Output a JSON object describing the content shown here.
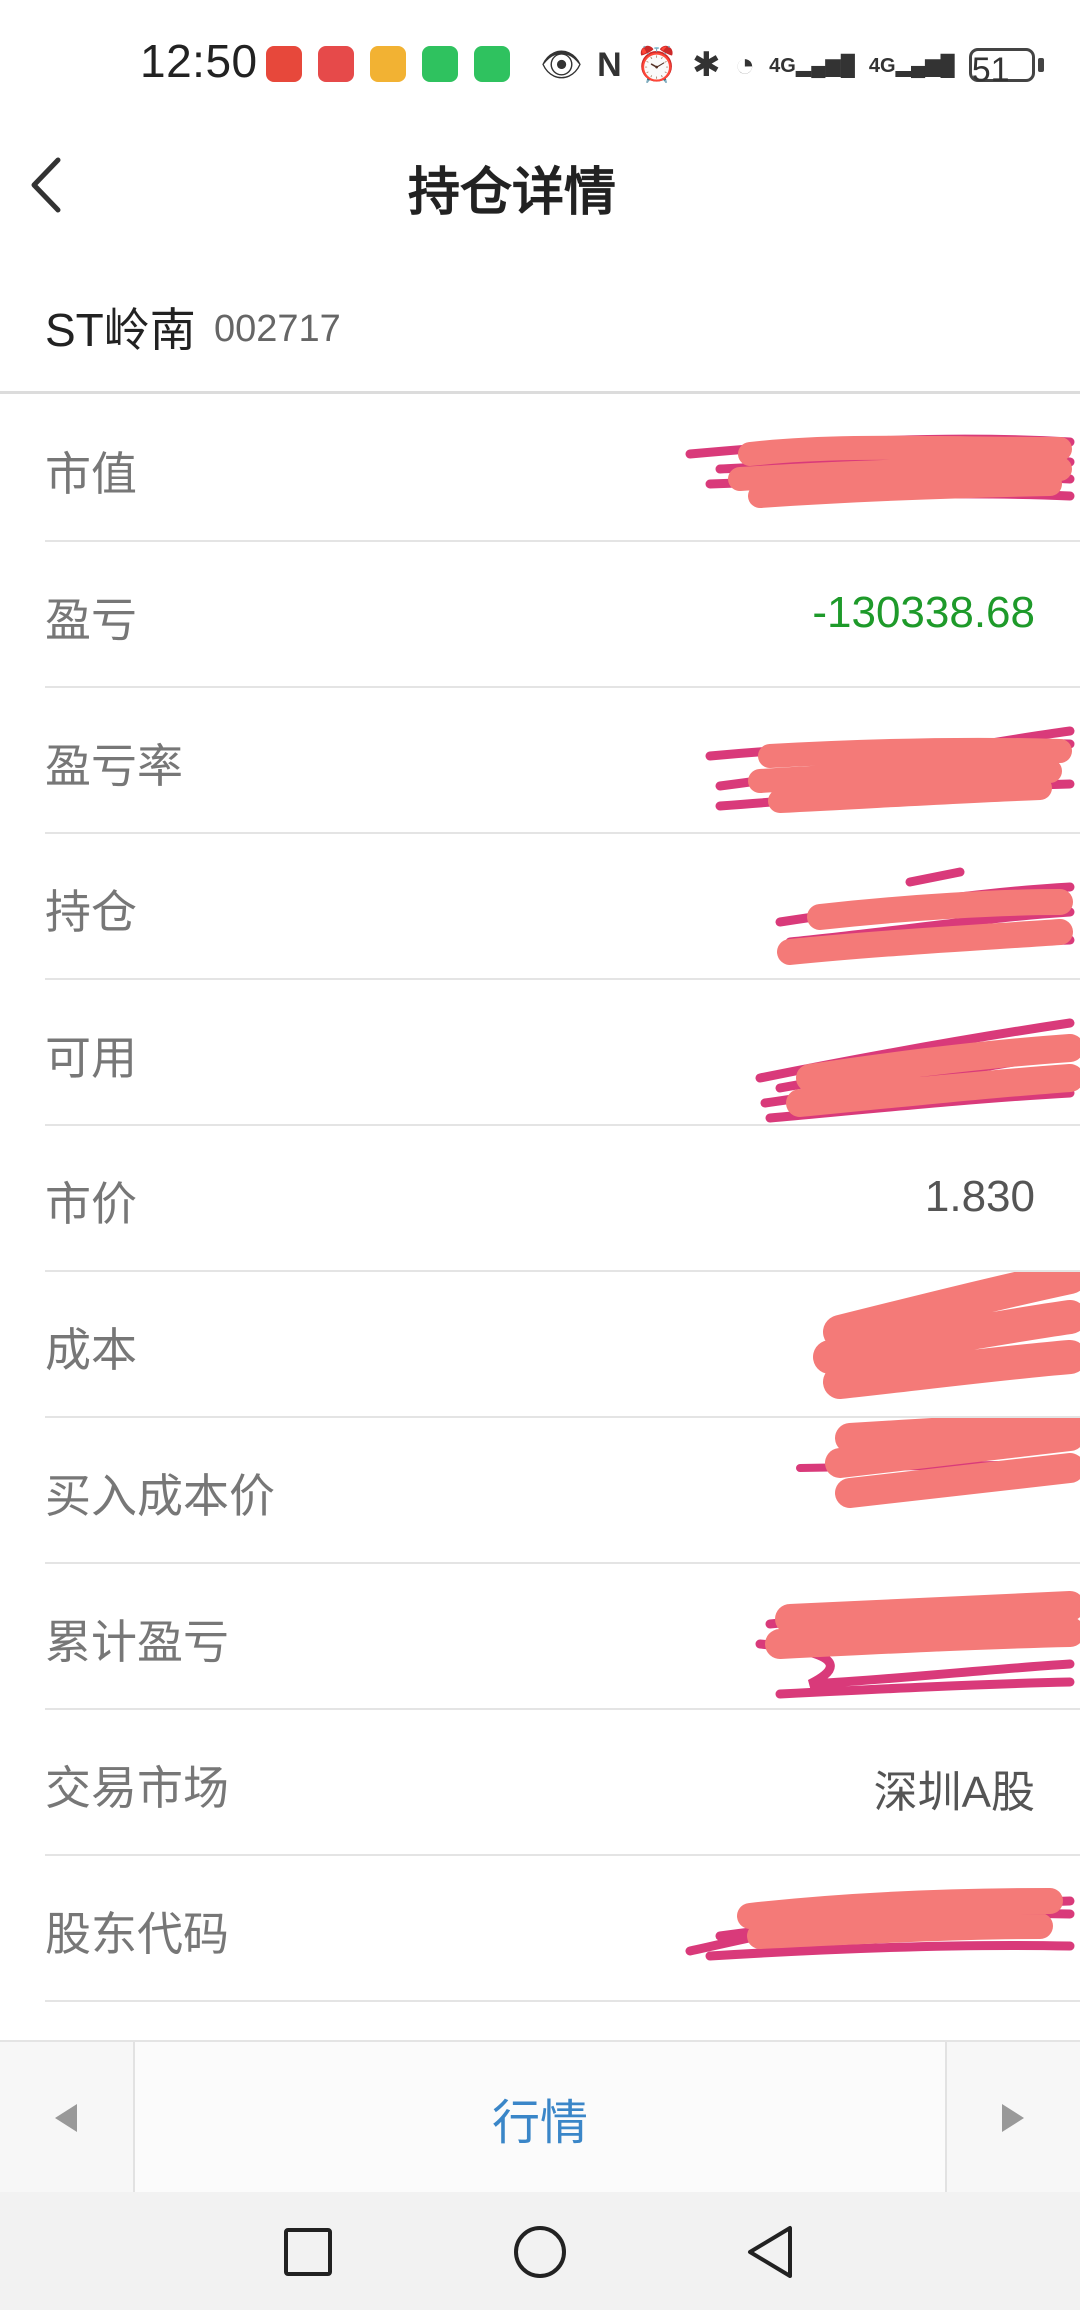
{
  "status_bar": {
    "time": "12:50",
    "notification_icons": [
      "app-red-icon",
      "app-book-icon",
      "weibo-icon",
      "wechat-icon",
      "wechat-icon"
    ],
    "notification_colors": [
      "#e7483b",
      "#e64a4a",
      "#f2b233",
      "#2fc25f",
      "#2fc25f"
    ],
    "system_icons": [
      "eye-icon",
      "nfc-icon",
      "alarm-icon",
      "bluetooth-icon",
      "wifi-icon",
      "signal-4g-icon",
      "signal-4g-icon"
    ],
    "network_label_1": "4G",
    "network_label_2": "4G",
    "battery": "51"
  },
  "nav": {
    "back_icon": "chevron-left-icon",
    "title": "持仓详情"
  },
  "stock": {
    "name": "ST岭南",
    "code": "002717"
  },
  "rows": [
    {
      "label": "市值",
      "value": "",
      "redacted": true
    },
    {
      "label": "盈亏",
      "value": "-130338.68",
      "redacted": false,
      "negative": true
    },
    {
      "label": "盈亏率",
      "value": "",
      "redacted": true
    },
    {
      "label": "持仓",
      "value": "",
      "redacted": true
    },
    {
      "label": "可用",
      "value": "",
      "redacted": true
    },
    {
      "label": "市价",
      "value": "1.830",
      "redacted": false
    },
    {
      "label": "成本",
      "value": "",
      "redacted": true
    },
    {
      "label": "买入成本价",
      "value": "",
      "redacted": true
    },
    {
      "label": "累计盈亏",
      "value": "",
      "redacted": true
    },
    {
      "label": "交易市场",
      "value": "深圳A股",
      "redacted": false
    },
    {
      "label": "股东代码",
      "value": "",
      "redacted": true
    }
  ],
  "tabbar": {
    "prev_icon": "triangle-left-icon",
    "center_label": "行情",
    "next_icon": "triangle-right-icon"
  },
  "system_nav": [
    "recents-square-icon",
    "home-circle-icon",
    "back-triangle-icon"
  ],
  "colors": {
    "negative": "#1e9a2a",
    "tab_active": "#3a86c8",
    "redaction_pink": "#f47a78",
    "redaction_magenta": "#d93a7a"
  }
}
